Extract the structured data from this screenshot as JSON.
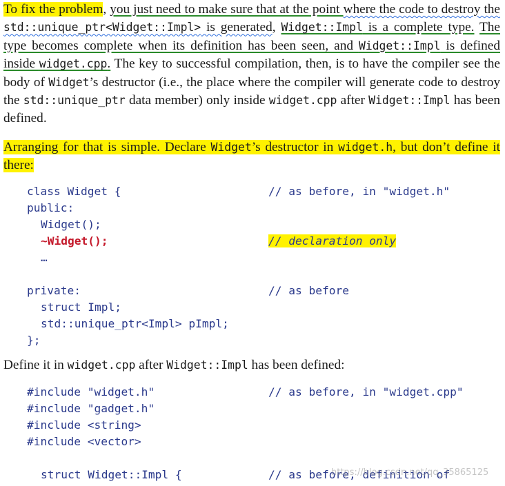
{
  "para1": {
    "s1": "To fix the problem",
    "s2": ", ",
    "s3": "you just need to make sure that at the point ",
    "s4": "where the code to destroy the ",
    "s5": "std::unique_ptr<Widget::Impl>",
    "s6": " is generated",
    "s7": ", ",
    "s8": "Widget::Impl",
    "s9": " is a complete type.",
    "s10": " ",
    "s11": "The type becomes complete when its definition has been seen, and ",
    "s12": "Widget::Impl",
    "s13": " is defined inside ",
    "s14": "widget.cpp",
    "s15": ".",
    "s16": " The key to successful compilation, then, is to have the compiler see the body of ",
    "s17": "Widget",
    "s18": "’s destructor (i.e., the place where the compiler will generate code to destroy the ",
    "s19": "std::unique_ptr",
    "s20": " data member) only inside ",
    "s21": "widget.cpp",
    "s22": " after ",
    "s23": "Widget::Impl",
    "s24": " has been defined."
  },
  "para2": {
    "s1": "Arranging for that is simple. Declare ",
    "s2": "Widget",
    "s3": "’s destructor in ",
    "s4": "widget.h",
    "s5": ", but don’t define it there:"
  },
  "code1": {
    "l1": "class Widget {",
    "l1c": "// as before, in \"widget.h\"",
    "l2": "public:",
    "l3": "Widget();",
    "l4": "~Widget();",
    "l4c": "// declaration only",
    "l5": "…",
    "l6": "private:",
    "l6c": "// as before",
    "l7": "struct Impl;",
    "l8": "std::unique_ptr<Impl> pImpl;",
    "l9": "};"
  },
  "para3": {
    "s1": "Define it in ",
    "s2": "widget.cpp",
    "s3": " after ",
    "s4": "Widget::Impl",
    "s5": " has been defined:"
  },
  "code2": {
    "l1": "#include \"widget.h\"",
    "l1c": "// as before, in \"widget.cpp\"",
    "l2": "#include \"gadget.h\"",
    "l3": "#include <string>",
    "l4": "#include <vector>",
    "l5": "struct Widget::Impl {",
    "l5c": "// as before, definition of"
  },
  "watermark": "https://blog.csdn.net/qq_35865125",
  "colors": {
    "highlight": "#fff200",
    "underline_green": "#2a8a2a",
    "underline_wavy": "#2f6fde",
    "code": "#2b3a8c",
    "code_emphasis": "#c4182a"
  }
}
